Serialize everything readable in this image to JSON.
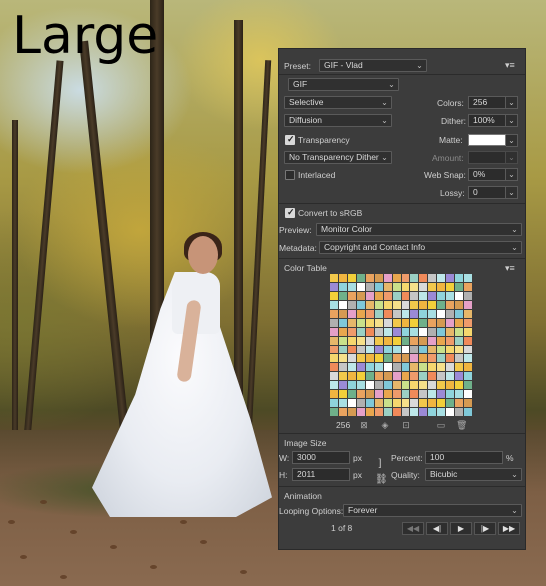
{
  "overlay": {
    "size_label": "Large"
  },
  "panel": {
    "preset": {
      "label": "Preset:",
      "value": "GIF - Vlad"
    },
    "format": {
      "value": "GIF"
    },
    "reduction": {
      "value": "Selective"
    },
    "colors": {
      "label": "Colors:",
      "value": "256"
    },
    "dither_algo": {
      "value": "Diffusion"
    },
    "dither": {
      "label": "Dither:",
      "value": "100%"
    },
    "transparency": {
      "label": "Transparency",
      "checked": true
    },
    "matte": {
      "label": "Matte:",
      "color": "#ffffff"
    },
    "transparency_dither": {
      "value": "No Transparency Dither"
    },
    "amount": {
      "label": "Amount:",
      "value": ""
    },
    "interlaced": {
      "label": "Interlaced",
      "checked": false
    },
    "web_snap": {
      "label": "Web Snap:",
      "value": "0%"
    },
    "lossy": {
      "label": "Lossy:",
      "value": "0"
    },
    "convert_srgb": {
      "label": "Convert to sRGB",
      "checked": true
    },
    "preview": {
      "label": "Preview:",
      "value": "Monitor Color"
    },
    "metadata": {
      "label": "Metadata:",
      "value": "Copyright and Contact Info"
    },
    "color_table": {
      "title": "Color Table",
      "count": "256"
    },
    "image_size": {
      "title": "Image Size",
      "w_label": "W:",
      "w_value": "3000",
      "w_unit": "px",
      "h_label": "H:",
      "h_value": "2011",
      "h_unit": "px",
      "percent_label": "Percent:",
      "percent_value": "100",
      "percent_unit": "%",
      "quality_label": "Quality:",
      "quality_value": "Bicubic"
    },
    "animation": {
      "title": "Animation",
      "looping_label": "Looping Options:",
      "looping_value": "Forever",
      "frame_counter": "1 of 8"
    }
  },
  "colors": {
    "panel_bg": "#3c3c3c",
    "palette": [
      "#f2c84b",
      "#e8a64e",
      "#8fd4dc",
      "#f5d76e",
      "#e9a35f",
      "#c6c6c6",
      "#7fc8d8",
      "#f0b540",
      "#ef9b6b",
      "#a8dfe3",
      "#f6e08a",
      "#d59a52",
      "#bde7e9",
      "#e6b76a",
      "#f2cf3a",
      "#9bd0c4",
      "#ffffff",
      "#d9d9d9",
      "#e5a0c8",
      "#9b8ad6",
      "#c9e08a",
      "#6fb08a",
      "#f08a5a",
      "#b0b0b0"
    ]
  }
}
